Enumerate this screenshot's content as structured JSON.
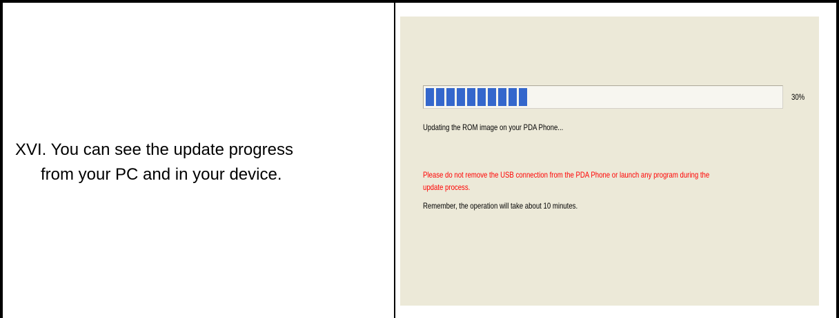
{
  "step": {
    "line1": "XVI. You can see the update progress",
    "line2": "from your PC and in your device."
  },
  "dialog": {
    "progress_value": 0.3,
    "progress_label": "30%",
    "status": "Updating the ROM image on your PDA Phone...",
    "warning_line1": "Please do not remove the USB connection from the PDA Phone or launch any program during the",
    "warning_line2": "update process.",
    "remember": "Remember, the operation will take about 10 minutes."
  },
  "colors": {
    "dialog_background": "#ece9d8",
    "progress_fill": "#3467cc",
    "warning_text": "#ff0000"
  }
}
